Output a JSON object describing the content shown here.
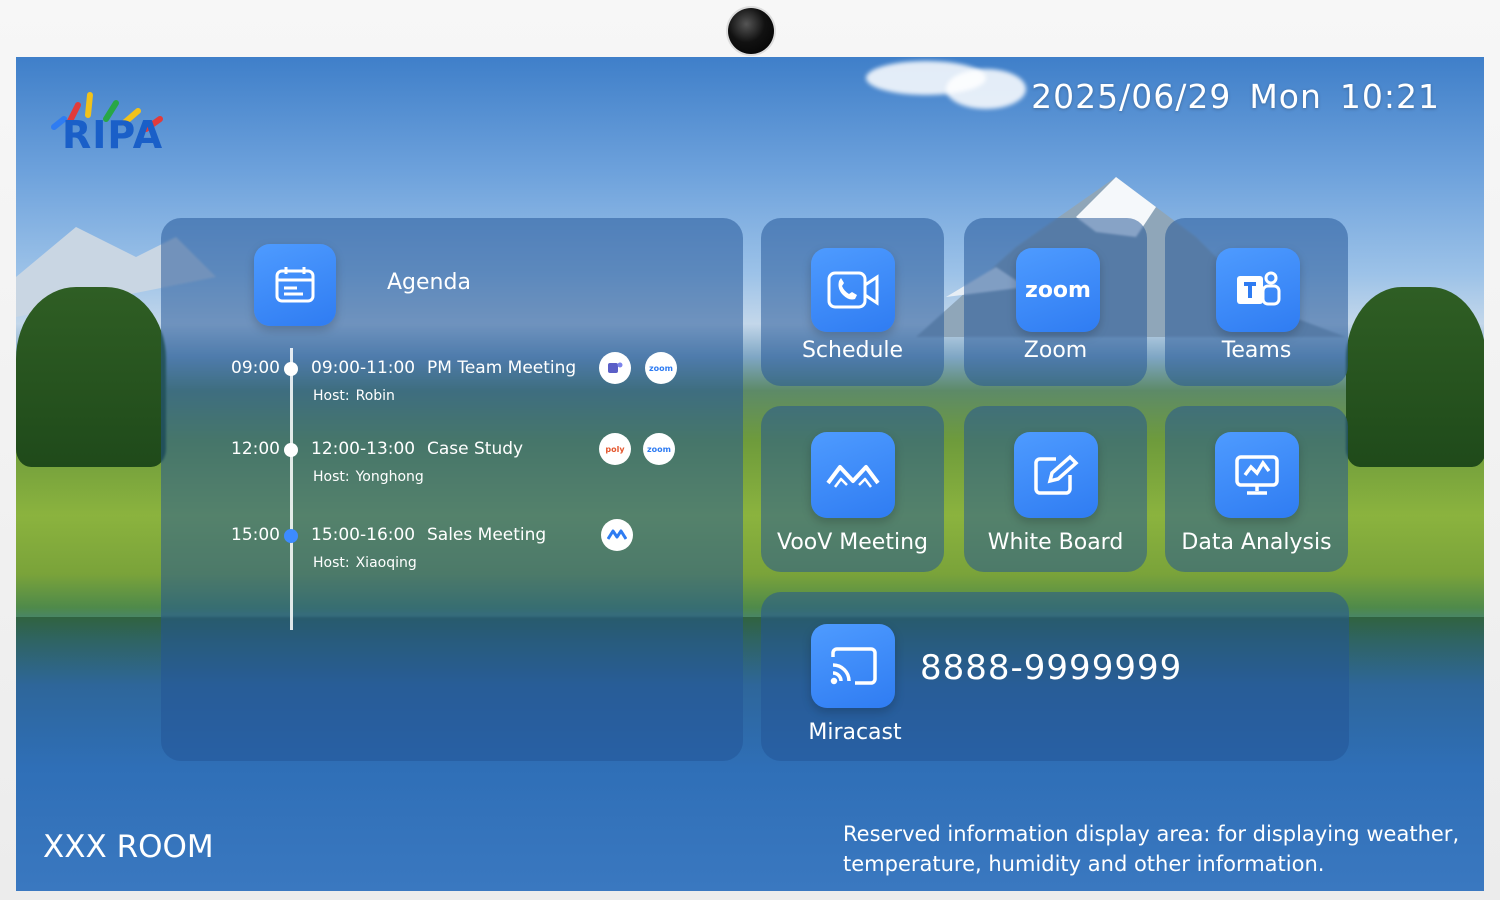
{
  "brand": {
    "name": "RIPA"
  },
  "clock": {
    "date": "2025/06/29",
    "weekday": "Mon",
    "time": "10:21"
  },
  "agenda": {
    "title": "Agenda",
    "host_label": "Host:",
    "items": [
      {
        "time": "09:00",
        "range": "09:00-11:00",
        "title": "PM Team Meeting",
        "host": "Robin",
        "apps": [
          "teams-icon",
          "zoom-icon"
        ],
        "apps_text": [
          "",
          "zoom"
        ],
        "current": false
      },
      {
        "time": "12:00",
        "range": "12:00-13:00",
        "title": "Case Study",
        "host": "Yonghong",
        "apps": [
          "poly-icon",
          "zoom-icon"
        ],
        "apps_text": [
          "poly",
          "zoom"
        ],
        "current": false
      },
      {
        "time": "15:00",
        "range": "15:00-16:00",
        "title": "Sales Meeting",
        "host": "Xiaoqing",
        "apps": [
          "voov-icon"
        ],
        "apps_text": [
          ""
        ],
        "current": true
      }
    ]
  },
  "apps": [
    {
      "label": "Schedule",
      "icon": "phone-video-icon"
    },
    {
      "label": "Zoom",
      "icon": "zoom-icon",
      "icon_text": "zoom"
    },
    {
      "label": "Teams",
      "icon": "teams-icon"
    },
    {
      "label": "VooV Meeting",
      "icon": "voov-icon"
    },
    {
      "label": "White Board",
      "icon": "whiteboard-icon"
    },
    {
      "label": "Data Analysis",
      "icon": "monitor-chart-icon"
    }
  ],
  "miracast": {
    "label": "Miracast",
    "code": "8888-9999999",
    "icon": "cast-icon"
  },
  "room": {
    "name": "XXX ROOM"
  },
  "info": {
    "text": "Reserved information display area: for displaying weather, temperature, humidity and other information."
  },
  "colors": {
    "accent": "#2f7cf2",
    "panel": "rgba(35,85,150,0.52)"
  }
}
